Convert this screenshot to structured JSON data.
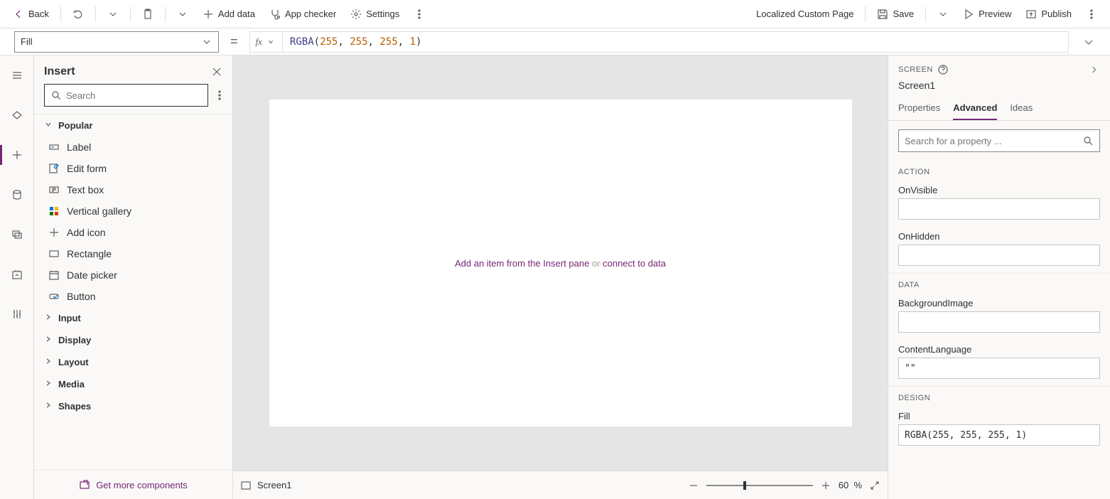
{
  "topbar": {
    "back": "Back",
    "add_data": "Add data",
    "app_checker": "App checker",
    "settings": "Settings",
    "page_label": "Localized Custom Page",
    "save": "Save",
    "preview": "Preview",
    "publish": "Publish"
  },
  "formula": {
    "property": "Fill",
    "fx": "fx",
    "fn": "RGBA",
    "args": [
      "255",
      "255",
      "255",
      "1"
    ]
  },
  "insert": {
    "title": "Insert",
    "search_placeholder": "Search",
    "categories": {
      "popular": "Popular",
      "input": "Input",
      "display": "Display",
      "layout": "Layout",
      "media": "Media",
      "shapes": "Shapes"
    },
    "popular_items": [
      {
        "label": "Label",
        "icon": "label-icon"
      },
      {
        "label": "Edit form",
        "icon": "edit-form-icon"
      },
      {
        "label": "Text box",
        "icon": "text-box-icon"
      },
      {
        "label": "Vertical gallery",
        "icon": "gallery-icon"
      },
      {
        "label": "Add icon",
        "icon": "plus-icon"
      },
      {
        "label": "Rectangle",
        "icon": "rectangle-icon"
      },
      {
        "label": "Date picker",
        "icon": "calendar-icon"
      },
      {
        "label": "Button",
        "icon": "button-icon"
      }
    ],
    "footer": "Get more components"
  },
  "canvas": {
    "hint_prefix": "Add an item from the Insert pane",
    "hint_or": " or ",
    "hint_link": "connect to data",
    "screen_name": "Screen1",
    "zoom_value": "60",
    "zoom_unit": "%"
  },
  "right": {
    "screen_label": "SCREEN",
    "screen_name": "Screen1",
    "tabs": {
      "properties": "Properties",
      "advanced": "Advanced",
      "ideas": "Ideas"
    },
    "search_placeholder": "Search for a property ...",
    "sections": {
      "action": "ACTION",
      "data": "DATA",
      "design": "DESIGN"
    },
    "fields": {
      "onvisible": {
        "label": "OnVisible",
        "value": ""
      },
      "onhidden": {
        "label": "OnHidden",
        "value": ""
      },
      "backgroundimage": {
        "label": "BackgroundImage",
        "value": ""
      },
      "contentlanguage": {
        "label": "ContentLanguage",
        "value": "\"\""
      },
      "fill": {
        "label": "Fill",
        "value": "RGBA(255, 255, 255, 1)"
      }
    }
  }
}
